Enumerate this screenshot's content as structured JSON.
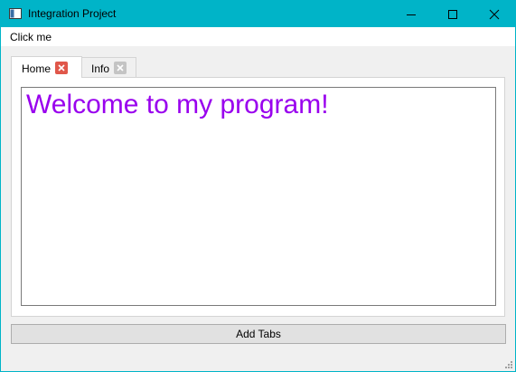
{
  "window": {
    "title": "Integration Project",
    "accent_color": "#00b4c8",
    "icons": {
      "app": "window-app-icon",
      "minimize": "minimize-icon",
      "maximize": "maximize-icon",
      "close": "close-icon"
    }
  },
  "menu": {
    "items": [
      {
        "label": "Click me"
      }
    ]
  },
  "tabs": {
    "active": "Home",
    "items": [
      {
        "label": "Home",
        "close_icon": "tab-close-icon",
        "close_color": "#e0574a"
      },
      {
        "label": "Info",
        "close_icon": "tab-close-icon",
        "close_color": "#c4c4c4"
      }
    ]
  },
  "home": {
    "text": "Welcome to my program!",
    "text_color": "#9900ee"
  },
  "actions": {
    "add_tabs_label": "Add Tabs"
  }
}
